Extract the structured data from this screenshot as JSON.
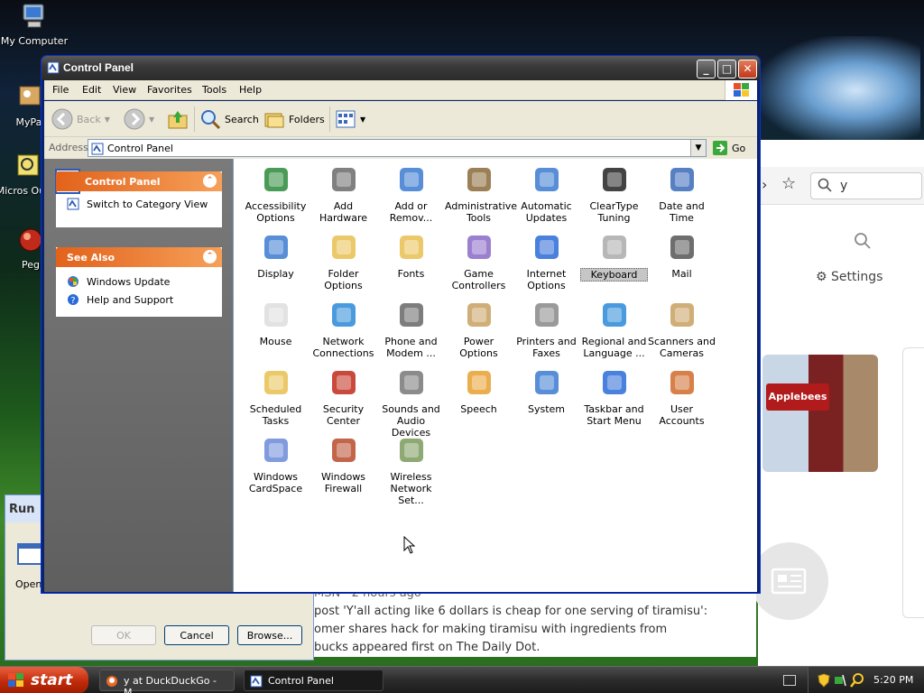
{
  "desktop": {
    "icons": [
      {
        "label": "My Computer"
      },
      {
        "label": "MyPa"
      },
      {
        "label": "Micros Outlo"
      },
      {
        "label": "Peg"
      }
    ]
  },
  "browser_bg": {
    "search_value": "y",
    "settings_label": "Settings",
    "sign_text": "Applebees",
    "news_source": "MSN",
    "news_time": "· 2 hours ago",
    "news_lines": [
      "post 'Y'all acting like 6 dollars is cheap for one serving of tiramisu':",
      "omer shares hack for making tiramisu with ingredients from",
      "bucks appeared first on The Daily Dot."
    ]
  },
  "run_dialog": {
    "title": "Run",
    "open_label": "Open",
    "ok_label": "OK",
    "cancel_label": "Cancel",
    "browse_label": "Browse..."
  },
  "window": {
    "title": "Control Panel",
    "menu": [
      "File",
      "Edit",
      "View",
      "Favorites",
      "Tools",
      "Help"
    ],
    "toolbar": {
      "back_label": "Back",
      "search_label": "Search",
      "folders_label": "Folders"
    },
    "address": {
      "label": "Address",
      "value": "Control Panel",
      "go_label": "Go"
    }
  },
  "left_pane": {
    "control_panel": {
      "header": "Control Panel",
      "switch_link": "Switch to Category View"
    },
    "see_also": {
      "header": "See Also",
      "links": [
        "Windows Update",
        "Help and Support"
      ]
    }
  },
  "items": [
    [
      "Accessibility",
      "Options"
    ],
    [
      "Add Hardware",
      ""
    ],
    [
      "Add or",
      "Remov..."
    ],
    [
      "Administrative",
      "Tools"
    ],
    [
      "Automatic",
      "Updates"
    ],
    [
      "ClearType",
      "Tuning"
    ],
    [
      "Date and Time",
      ""
    ],
    [
      "Display",
      ""
    ],
    [
      "Folder Options",
      ""
    ],
    [
      "Fonts",
      ""
    ],
    [
      "Game",
      "Controllers"
    ],
    [
      "Internet",
      "Options"
    ],
    [
      "Keyboard",
      ""
    ],
    [
      "Mail",
      ""
    ],
    [
      "Mouse",
      ""
    ],
    [
      "Network",
      "Connections"
    ],
    [
      "Phone and",
      "Modem ..."
    ],
    [
      "Power Options",
      ""
    ],
    [
      "Printers and",
      "Faxes"
    ],
    [
      "Regional and",
      "Language ..."
    ],
    [
      "Scanners and",
      "Cameras"
    ],
    [
      "Scheduled",
      "Tasks"
    ],
    [
      "Security",
      "Center"
    ],
    [
      "Sounds and",
      "Audio Devices"
    ],
    [
      "Speech",
      ""
    ],
    [
      "System",
      ""
    ],
    [
      "Taskbar and",
      "Start Menu"
    ],
    [
      "User Accounts",
      ""
    ],
    [
      "Windows",
      "CardSpace"
    ],
    [
      "Windows",
      "Firewall"
    ],
    [
      "Wireless",
      "Network Set..."
    ]
  ],
  "selected_item": "Keyboard",
  "taskbar": {
    "start_label": "start",
    "tasks": [
      "y at DuckDuckGo - M...",
      "Control Panel"
    ],
    "clock": "5:20 PM"
  }
}
